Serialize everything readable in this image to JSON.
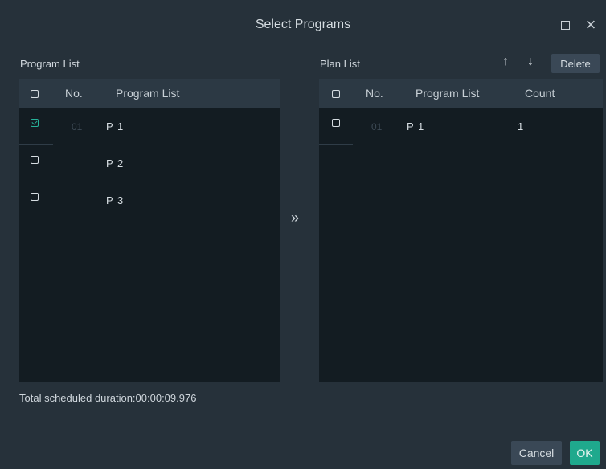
{
  "window": {
    "title": "Select Programs",
    "maximize_icon": "maximize-icon",
    "close_icon": "close-icon",
    "close_glyph": "×"
  },
  "program_list": {
    "label": "Program List",
    "columns": {
      "no": "No.",
      "program": "Program List"
    },
    "rows": [
      {
        "no": "01",
        "name": "P 1",
        "checked": true
      },
      {
        "no": "",
        "name": "P 2",
        "checked": false
      },
      {
        "no": "",
        "name": "P 3",
        "checked": false
      }
    ]
  },
  "plan_list": {
    "label": "Plan List",
    "up_glyph": "↑",
    "down_glyph": "↓",
    "delete_label": "Delete",
    "columns": {
      "no": "No.",
      "program": "Program List",
      "count": "Count"
    },
    "rows": [
      {
        "no": "01",
        "name": "P 1",
        "count": "1",
        "checked": false
      }
    ]
  },
  "move_glyph": "»",
  "footer": {
    "duration": "Total scheduled duration:00:00:09.976",
    "cancel_label": "Cancel",
    "ok_label": "OK"
  },
  "colors": {
    "accent": "#1fa98d",
    "background": "#26313a",
    "panel": "#131c22",
    "header": "#2c3944"
  }
}
